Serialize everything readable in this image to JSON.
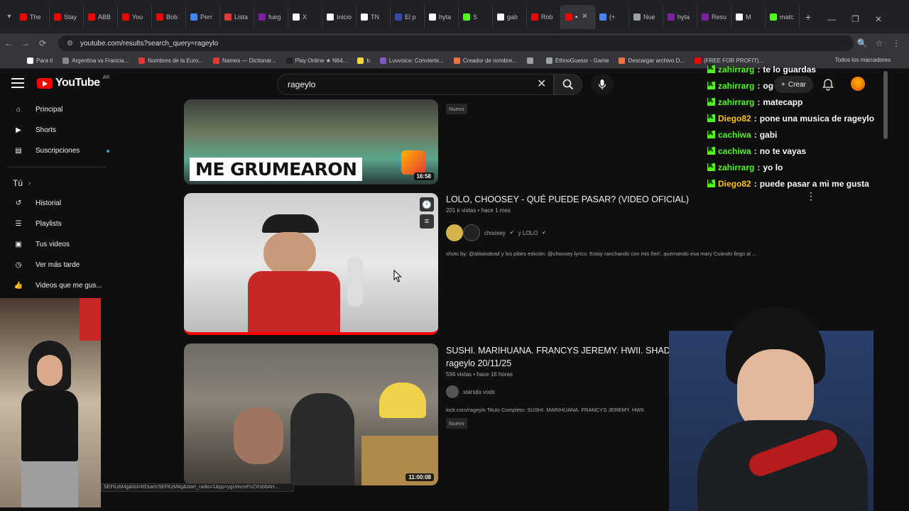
{
  "browser": {
    "tabs": [
      {
        "label": "The",
        "color": "#ff0000"
      },
      {
        "label": "Stay",
        "color": "#ff0000"
      },
      {
        "label": "ABB",
        "color": "#ff0000"
      },
      {
        "label": "You",
        "color": "#ff0000"
      },
      {
        "label": "Bob",
        "color": "#ff0000"
      },
      {
        "label": "Perr",
        "color": "#4285f4"
      },
      {
        "label": "Lista",
        "color": "#e53935"
      },
      {
        "label": "fueg",
        "color": "#7b1fa2"
      },
      {
        "label": "X",
        "color": "#ffffff"
      },
      {
        "label": "Inicio",
        "color": "#ffffff"
      },
      {
        "label": "TN",
        "color": "#ffffff"
      },
      {
        "label": "El p",
        "color": "#3949ab"
      },
      {
        "label": "hyta",
        "color": "#ffffff"
      },
      {
        "label": "S",
        "color": "#53fc18"
      },
      {
        "label": "gab",
        "color": "#ffffff"
      },
      {
        "label": "Rob",
        "color": "#ff0000"
      },
      {
        "label": "•",
        "color": "#ff0000",
        "active": true
      },
      {
        "label": "(+",
        "color": "#4285f4"
      },
      {
        "label": "Nue",
        "color": "#9aa0a6"
      },
      {
        "label": "hyta",
        "color": "#7b1fa2"
      },
      {
        "label": "Resu",
        "color": "#7b1fa2"
      },
      {
        "label": "M",
        "color": "#ffffff"
      },
      {
        "label": "matc",
        "color": "#53fc18"
      }
    ],
    "url": "youtube.com/results?search_query=rageylo",
    "bookmarks": [
      {
        "label": "Para ti",
        "color": "#ffffff"
      },
      {
        "label": "Argentina vs Francia...",
        "color": "#888888"
      },
      {
        "label": "Nombres de la Euro...",
        "color": "#e53935"
      },
      {
        "label": "Names — Dictionar...",
        "color": "#e53935"
      },
      {
        "label": "Play Online ★ N64...",
        "color": "#222222"
      },
      {
        "label": "b",
        "color": "#fdd835"
      },
      {
        "label": "Luvvoice: Convierte...",
        "color": "#7e57c2"
      },
      {
        "label": "Creador de nombre...",
        "color": "#ff7043"
      },
      {
        "label": "",
        "color": "#9aa0a6"
      },
      {
        "label": "EthnoGuessr - Game",
        "color": "#9aa0a6"
      },
      {
        "label": "Descargar archivo D...",
        "color": "#ff7043"
      },
      {
        "label": "(FREE FOR PROFIT)...",
        "color": "#ff0000"
      }
    ],
    "all_bookmarks": "Todos los marcadores"
  },
  "youtube": {
    "logo_text": "YouTube",
    "country": "AR",
    "search_value": "rageylo",
    "create_label": "Crear",
    "sidebar": {
      "items": [
        {
          "label": "Principal",
          "icon": "home-icon"
        },
        {
          "label": "Shorts",
          "icon": "shorts-icon"
        },
        {
          "label": "Suscripciones",
          "icon": "subscriptions-icon"
        }
      ],
      "you_heading": "Tú",
      "you_items": [
        {
          "label": "Historial",
          "icon": "history-icon"
        },
        {
          "label": "Playlists",
          "icon": "playlists-icon"
        },
        {
          "label": "Tus videos",
          "icon": "your-videos-icon"
        },
        {
          "label": "Ver más tarde",
          "icon": "watch-later-icon"
        },
        {
          "label": "Videos que me gus...",
          "icon": "like-icon"
        }
      ]
    },
    "videos": [
      {
        "thumb_text": "ME GRUMEARON",
        "duration": "16:58",
        "badge": "Nuevo"
      },
      {
        "title": "LOLO, CHOOSEY - QUÉ PUEDE PASAR? (VIDEO OFICIAL)",
        "meta": "201 k vistas • hace 1 mes",
        "channel": "choosey",
        "channel_suffix": "y LOLO",
        "description": "shots by: @alitaisdead y los pibes edición: @choosey lyrics: Estoy ranchando con mis ñeri', quemando esa mary Cuando llego al ..."
      },
      {
        "title_line1": "SUSHI. MARIHUANA. FRANCYS JEREMY. HWII. SHADY.",
        "title_line2": "rageylo 20/11/25",
        "meta": "594 vistas • hace 16 horas",
        "channel": "starsito vods",
        "description": "kick.com/rageylo Titulo Completo: SUSHI. MARIHUANA. FRANCYS JEREMY. HWII.",
        "badge": "Nuevo",
        "duration": "11:00:08"
      }
    ]
  },
  "chat": [
    {
      "user": "zahirrarg",
      "msg": "te lo guardas",
      "color": "#53fc18"
    },
    {
      "user": "zahirrarg",
      "msg": "og",
      "color": "#53fc18"
    },
    {
      "user": "zahirrarg",
      "msg": "matecapp",
      "color": "#53fc18"
    },
    {
      "user": "Diego82",
      "msg": "pone una musica de rageylo",
      "color": "#ffc400"
    },
    {
      "user": "cachiwa",
      "msg": "gabi",
      "color": "#53fc18"
    },
    {
      "user": "cachiwa",
      "msg": "no te vayas",
      "color": "#53fc18"
    },
    {
      "user": "zahirrarg",
      "msg": "yo lo",
      "color": "#53fc18"
    },
    {
      "user": "Diego82",
      "msg": "puede pasar a mi me gusta",
      "color": "#ffc400"
    }
  ],
  "status_bar_url": "SEFKzM4g&list=RDuwVSEFKzM4g&start_radio=1&pp=ygUHcmFnZXlsb6AH..."
}
